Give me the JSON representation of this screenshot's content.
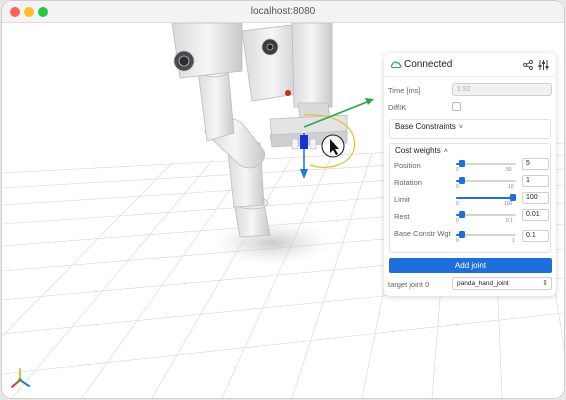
{
  "window": {
    "title": "localhost:8080"
  },
  "panel": {
    "status": "Connected",
    "time_label": "Time [ms]",
    "time_value": "2.92",
    "diffik_label": "DiffIK",
    "base_constraints_title": "Base Constraints",
    "base_constraints_chevron": "˅",
    "cost_weights_title": "Cost weights",
    "cost_weights_chevron": "˄",
    "sliders": [
      {
        "label": "Position",
        "min": "0",
        "max": "50",
        "value": "5",
        "fraction": 0.1
      },
      {
        "label": "Rotation",
        "min": "0",
        "max": "10",
        "value": "1",
        "fraction": 0.1
      },
      {
        "label": "Limit",
        "min": "0",
        "max": "100",
        "value": "100",
        "fraction": 1.0
      },
      {
        "label": "Rest",
        "min": "0",
        "max": "0.1",
        "value": "0.01",
        "fraction": 0.1
      },
      {
        "label": "Base Constr Wgt",
        "min": "0",
        "max": "1",
        "value": "0.1",
        "fraction": 0.1
      }
    ],
    "add_joint_label": "Add joint",
    "target_joint_label": "target joint 0",
    "target_joint_value": "panda_hand_joint"
  },
  "colors": {
    "accent": "#1e6fdc",
    "gizmo_x": "#2aa84a",
    "gizmo_y": "#1e7bd6",
    "gizmo_ring": "#e3c12b",
    "axes_red": "#e23b2e"
  },
  "icons": {
    "status": "cloud-icon",
    "share": "share-icon",
    "settings": "sliders-icon"
  }
}
